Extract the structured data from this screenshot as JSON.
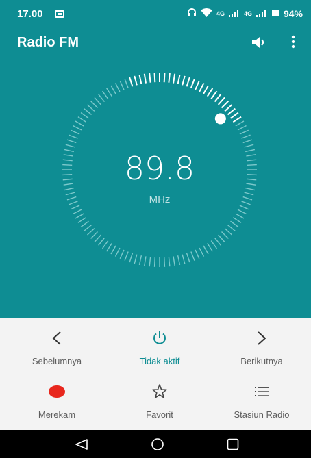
{
  "status_bar": {
    "time": "17.00",
    "net1": "4G",
    "net2": "4G",
    "battery": "94%"
  },
  "app_bar": {
    "title": "Radio FM",
    "icons": [
      "volume-icon",
      "more-vert-icon"
    ]
  },
  "tuner": {
    "frequency": "89.8",
    "unit": "MHz"
  },
  "controls": {
    "previous_label": "Sebelumnya",
    "power_label": "Tidak aktif",
    "next_label": "Berikutnya",
    "record_label": "Merekam",
    "favorite_label": "Favorit",
    "stations_label": "Stasiun Radio"
  },
  "colors": {
    "primary": "#0e8d93",
    "record": "#e8271d",
    "controls_bg": "#f3f3f3"
  }
}
